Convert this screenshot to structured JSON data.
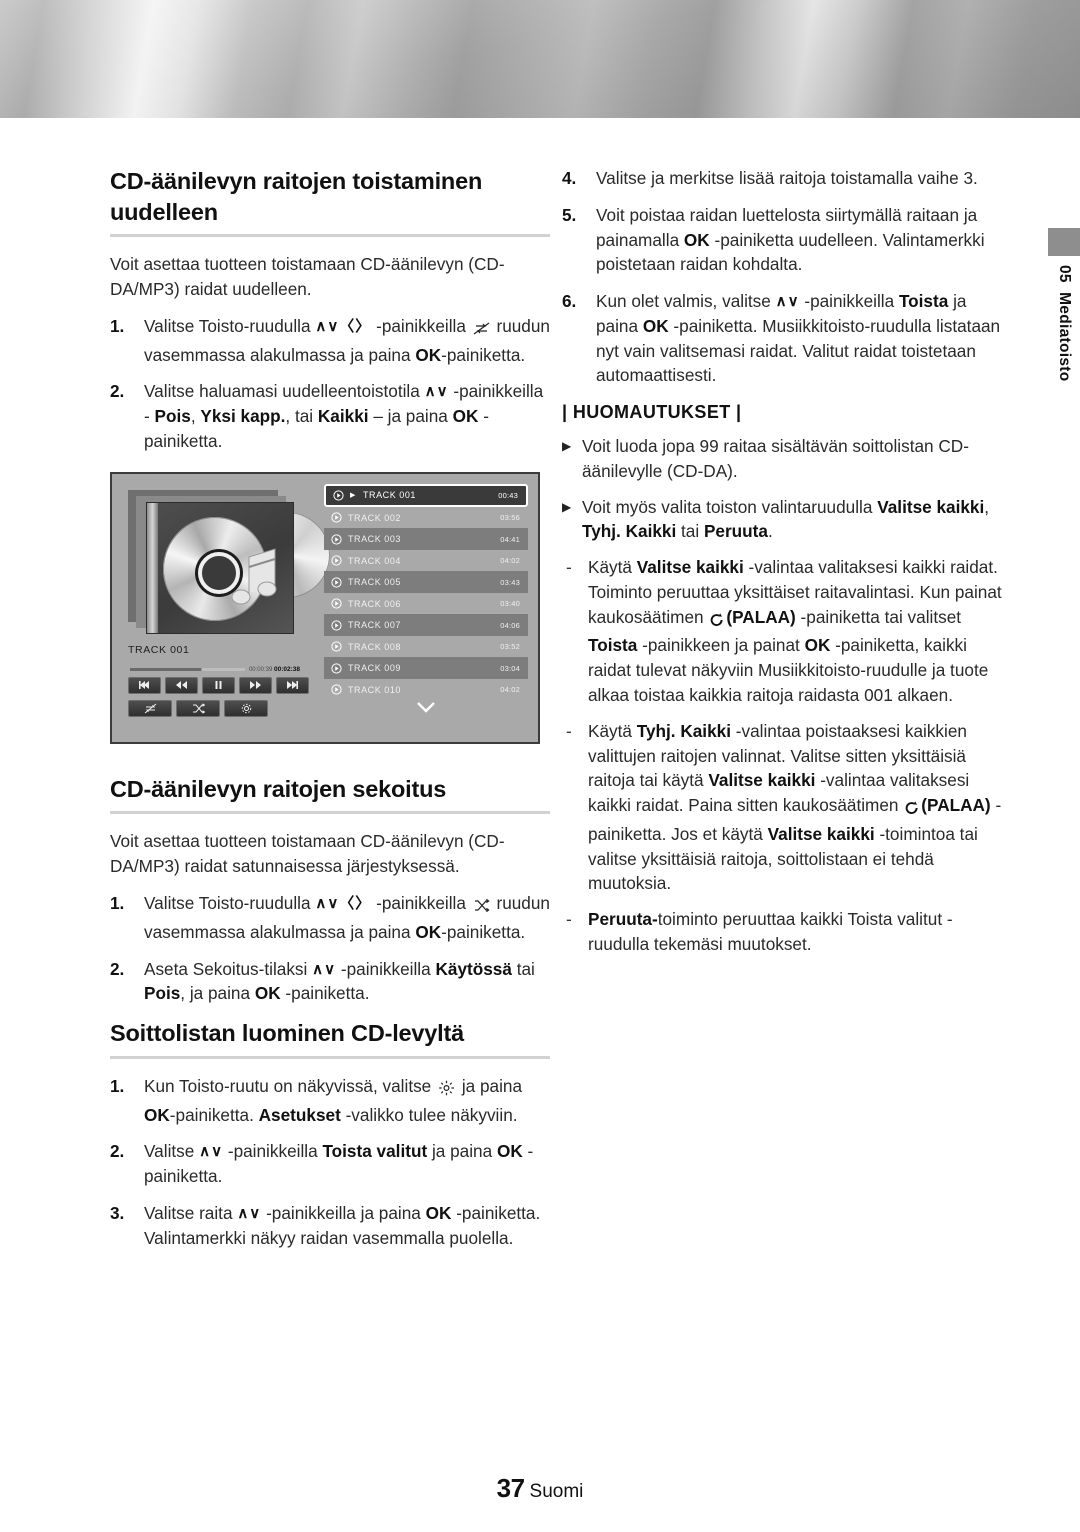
{
  "side_tab": {
    "chapter_number": "05",
    "chapter_label": "Mediatoisto"
  },
  "footer": {
    "page_number": "37",
    "language": "Suomi"
  },
  "left_column": {
    "section1": {
      "title": "CD-äänilevyn raitojen toistaminen uudelleen",
      "intro": "Voit asettaa tuotteen toistamaan CD-äänilevyn (CD-DA/MP3) raidat uudelleen.",
      "steps": [
        {
          "num": "1.",
          "part1": "Valitse Toisto-ruudulla",
          "keys": "∧∨〈〉",
          "part2": "-painikkeilla",
          "part3": "ruudun vasemmassa alakulmassa ja paina",
          "bold1": "OK",
          "part4": "-painiketta."
        },
        {
          "num": "2.",
          "part1": "Valitse haluamasi uudelleentoistotila",
          "keys": "∧∨",
          "part2": "-painikkeilla -",
          "bold1": "Pois",
          "sep1": ",",
          "bold2": "Yksi kapp.",
          "sep2": ", tai",
          "bold3": "Kaikki",
          "part3": "– ja paina",
          "bold4": "OK",
          "part4": "-painiketta."
        }
      ]
    },
    "screenshot": {
      "now_playing_label": "TRACK 001",
      "elapsed_time": "00:00:39",
      "total_time": "00:02:38",
      "transport_buttons": [
        "skip-previous",
        "rewind",
        "pause",
        "fast-forward",
        "skip-next"
      ],
      "option_buttons": [
        "repeat",
        "shuffle",
        "settings"
      ],
      "tracks": [
        {
          "name": "TRACK 001",
          "time": "00:43",
          "selected": true,
          "playing": true
        },
        {
          "name": "TRACK 002",
          "time": "03:56",
          "selected": false,
          "playing": false
        },
        {
          "name": "TRACK 003",
          "time": "04:41",
          "selected": false,
          "playing": false
        },
        {
          "name": "TRACK 004",
          "time": "04:02",
          "selected": false,
          "playing": false
        },
        {
          "name": "TRACK 005",
          "time": "03:43",
          "selected": false,
          "playing": false
        },
        {
          "name": "TRACK 006",
          "time": "03:40",
          "selected": false,
          "playing": false
        },
        {
          "name": "TRACK 007",
          "time": "04:06",
          "selected": false,
          "playing": false
        },
        {
          "name": "TRACK 008",
          "time": "03:52",
          "selected": false,
          "playing": false
        },
        {
          "name": "TRACK 009",
          "time": "03:04",
          "selected": false,
          "playing": false
        },
        {
          "name": "TRACK 010",
          "time": "04:02",
          "selected": false,
          "playing": false
        }
      ]
    },
    "section2": {
      "title": "CD-äänilevyn raitojen sekoitus",
      "intro": "Voit asettaa tuotteen toistamaan CD-äänilevyn (CD-DA/MP3) raidat satunnaisessa järjestyksessä.",
      "steps": [
        {
          "num": "1.",
          "part1": "Valitse Toisto-ruudulla",
          "keys": "∧∨〈〉",
          "part2": "-painikkeilla",
          "part3": "ruudun vasemmassa alakulmassa ja paina",
          "bold1": "OK",
          "part4": "-painiketta."
        },
        {
          "num": "2.",
          "part1": "Aseta Sekoitus-tilaksi",
          "keys": "∧∨",
          "part2": "-painikkeilla",
          "bold1": "Käytössä",
          "sep1": "tai",
          "bold2": "Pois",
          "part3": ", ja paina",
          "bold3": "OK",
          "part4": "-painiketta."
        }
      ]
    },
    "section3": {
      "title": "Soittolistan luominen CD-levyltä",
      "steps": [
        {
          "num": "1.",
          "part1": "Kun Toisto-ruutu on näkyvissä, valitse",
          "part2": "ja paina",
          "bold1": "OK",
          "part3": "-painiketta.",
          "bold2": "Asetukset",
          "part4": "-valikko tulee näkyviin."
        },
        {
          "num": "2.",
          "part1": "Valitse",
          "keys": "∧∨",
          "part2": "-painikkeilla",
          "bold1": "Toista valitut",
          "part3": "ja paina",
          "bold2": "OK",
          "part4": "-painiketta."
        },
        {
          "num": "3.",
          "part1": "Valitse raita",
          "keys": "∧∨",
          "part2": "-painikkeilla ja paina",
          "bold1": "OK",
          "part3": "-painiketta. Valintamerkki näkyy raidan vasemmalla puolella."
        }
      ]
    }
  },
  "right_column": {
    "steps": [
      {
        "num": "4.",
        "text": "Valitse ja merkitse lisää raitoja toistamalla vaihe 3."
      },
      {
        "num": "5.",
        "part1": "Voit poistaa raidan luettelosta siirtymällä raitaan ja painamalla",
        "bold1": "OK",
        "part2": "-painiketta uudelleen. Valintamerkki poistetaan raidan kohdalta."
      },
      {
        "num": "6.",
        "part1": "Kun olet valmis, valitse",
        "keys": "∧∨",
        "part2": "-painikkeilla",
        "bold1": "Toista",
        "part3": "ja paina",
        "bold2": "OK",
        "part4": "-painiketta. Musiikkitoisto-ruudulla listataan nyt vain valitsemasi raidat. Valitut raidat toistetaan automaattisesti."
      }
    ],
    "notes_heading": "| HUOMAUTUKSET |",
    "notes": [
      {
        "text": "Voit luoda jopa 99 raitaa sisältävän soittolistan CD-äänilevylle (CD-DA)."
      },
      {
        "part1": "Voit myös valita toiston valintaruudulla",
        "bold1": "Valitse kaikki",
        "sep1": ",",
        "bold2": "Tyhj. Kaikki",
        "sep2": "tai",
        "bold3": "Peruuta",
        "part2": "."
      }
    ],
    "subnotes": [
      {
        "part1": "Käytä",
        "bold1": "Valitse kaikki",
        "part2": "-valintaa valitaksesi kaikki raidat. Toiminto peruuttaa yksittäiset raitavalintasi. Kun painat kaukosäätimen",
        "bold2": "(PALAA)",
        "part3": "-painiketta tai valitset",
        "bold3": "Toista",
        "part4": "-painikkeen ja painat",
        "bold4": "OK",
        "part5": "-painiketta, kaikki raidat tulevat näkyviin Musiikkitoisto-ruudulle ja tuote alkaa toistaa kaikkia raitoja raidasta 001 alkaen."
      },
      {
        "part1": "Käytä",
        "bold1": "Tyhj. Kaikki",
        "part2": "-valintaa poistaaksesi kaikkien valittujen raitojen valinnat. Valitse sitten yksittäisiä raitoja tai käytä",
        "bold2": "Valitse kaikki",
        "part3": "-valintaa valitaksesi kaikki raidat. Paina sitten kaukosäätimen",
        "bold3": "(PALAA)",
        "part4": "-painiketta. Jos et käytä",
        "bold4": "Valitse kaikki",
        "part5": "-toimintoa tai valitse yksittäisiä raitoja, soittolistaan ei tehdä muutoksia."
      },
      {
        "bold1": "Peruuta-",
        "part1": "toiminto peruuttaa kaikki Toista valitut -ruudulla tekemäsi muutokset."
      }
    ]
  }
}
